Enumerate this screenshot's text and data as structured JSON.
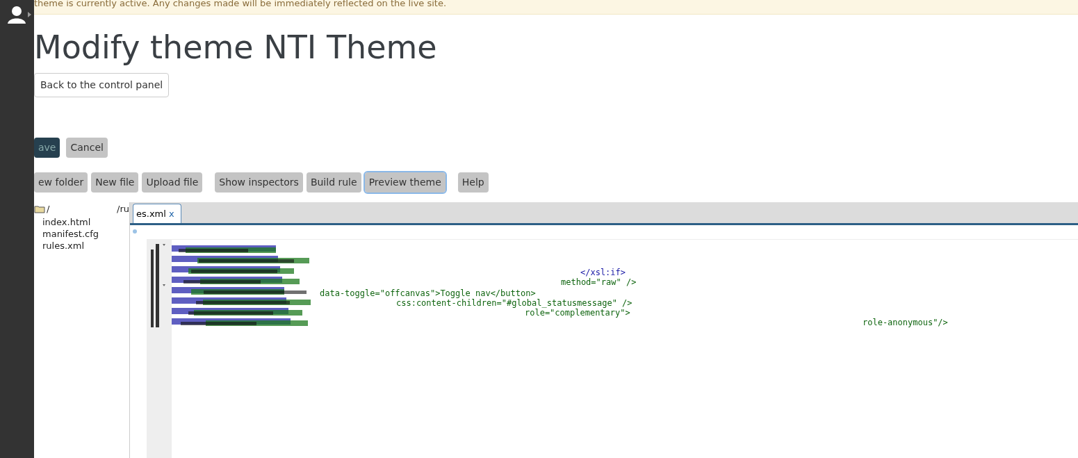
{
  "banner": {
    "text": "theme is currently active. Any changes made will be immediately reflected on the live site."
  },
  "title": "Modify theme NTI Theme",
  "back_button": "Back to the control panel",
  "form_buttons": [
    {
      "label": "ave",
      "kind": "primary"
    },
    {
      "label": "Cancel",
      "kind": "default"
    }
  ],
  "toolbar_groups": [
    [
      {
        "label": "ew folder",
        "focused": false
      },
      {
        "label": "New file",
        "focused": false
      },
      {
        "label": "Upload file",
        "focused": false
      }
    ],
    [
      {
        "label": "Show inspectors",
        "focused": false
      },
      {
        "label": "Build rule",
        "focused": false
      },
      {
        "label": "Preview theme",
        "focused": true
      }
    ],
    [
      {
        "label": "Help",
        "focused": false
      }
    ]
  ],
  "file_tree": {
    "root": "/",
    "children": [
      {
        "name": "index.html"
      },
      {
        "name": "manifest.cfg"
      },
      {
        "name": "rules.xml"
      }
    ]
  },
  "path": "/ru",
  "tabs": [
    {
      "label": "es.xml",
      "close": "x",
      "selected": true
    }
  ],
  "code_lines": [
    {
      "text": "</xsl:if>",
      "color": "#1a1aa6"
    },
    {
      "text": "method=\"raw\" />",
      "color": "#116611"
    },
    {
      "text": "data-toggle=\"offcanvas\">Toggle nav</button>",
      "color": "#116611"
    },
    {
      "text": "css:content-children=\"#global_statusmessage\" />",
      "color": "#116611"
    },
    {
      "text": "role=\"complementary\">",
      "color": "#116611"
    },
    {
      "text": "role-anonymous\"/>",
      "color": "#116611"
    }
  ]
}
